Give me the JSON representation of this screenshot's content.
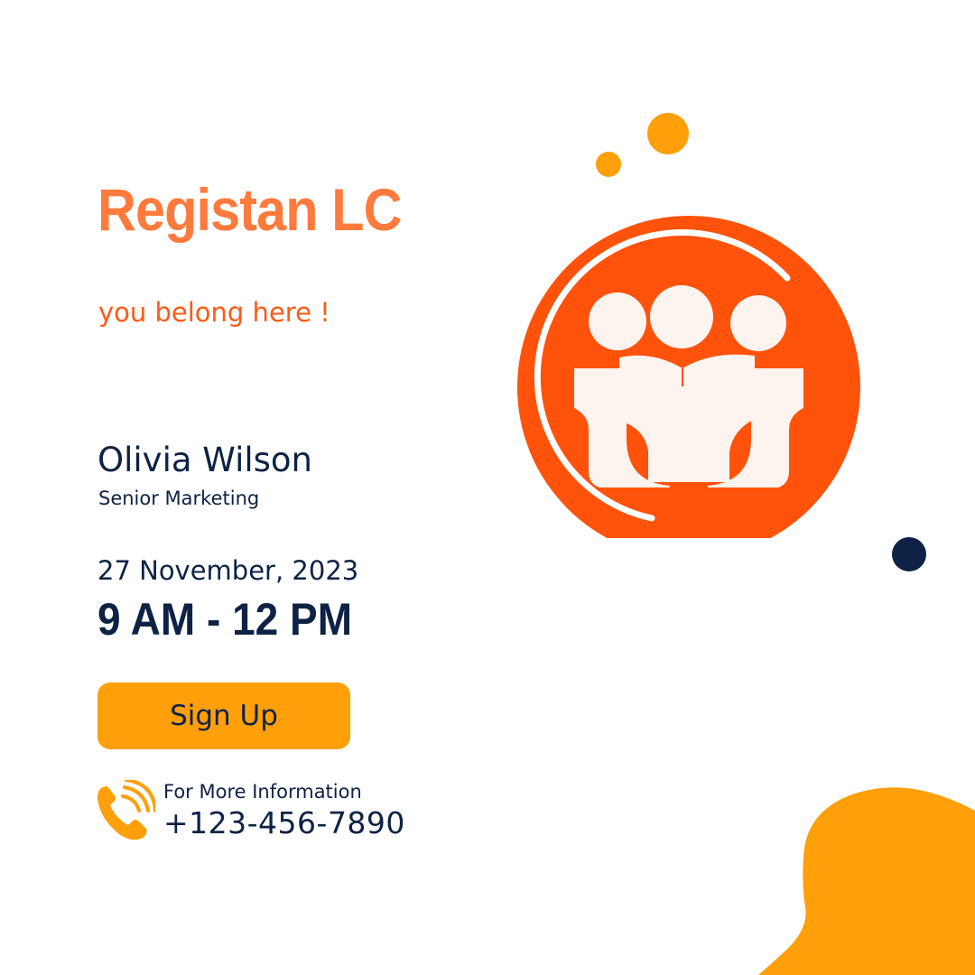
{
  "event": {
    "title": "Registan LC",
    "tagline": "you belong here !",
    "speaker_name": "Olivia Wilson",
    "speaker_role": "Senior Marketing",
    "date": "27 November, 2023",
    "time": "9 AM - 12 PM"
  },
  "signup": {
    "label": "Sign Up"
  },
  "contact": {
    "label": "For More Information",
    "phone": "+123-456-7890"
  },
  "icons": {
    "phone": "phone-ringing-icon",
    "logo": "three-people-reading-logo"
  },
  "colors": {
    "title": "#ff7a3d",
    "tagline": "#ff5a14",
    "navy": "#0d2244",
    "amber": "#ff9f0a",
    "logo_orange": "#ff520a",
    "logo_figures": "#fdf3ef",
    "white": "#ffffff"
  }
}
